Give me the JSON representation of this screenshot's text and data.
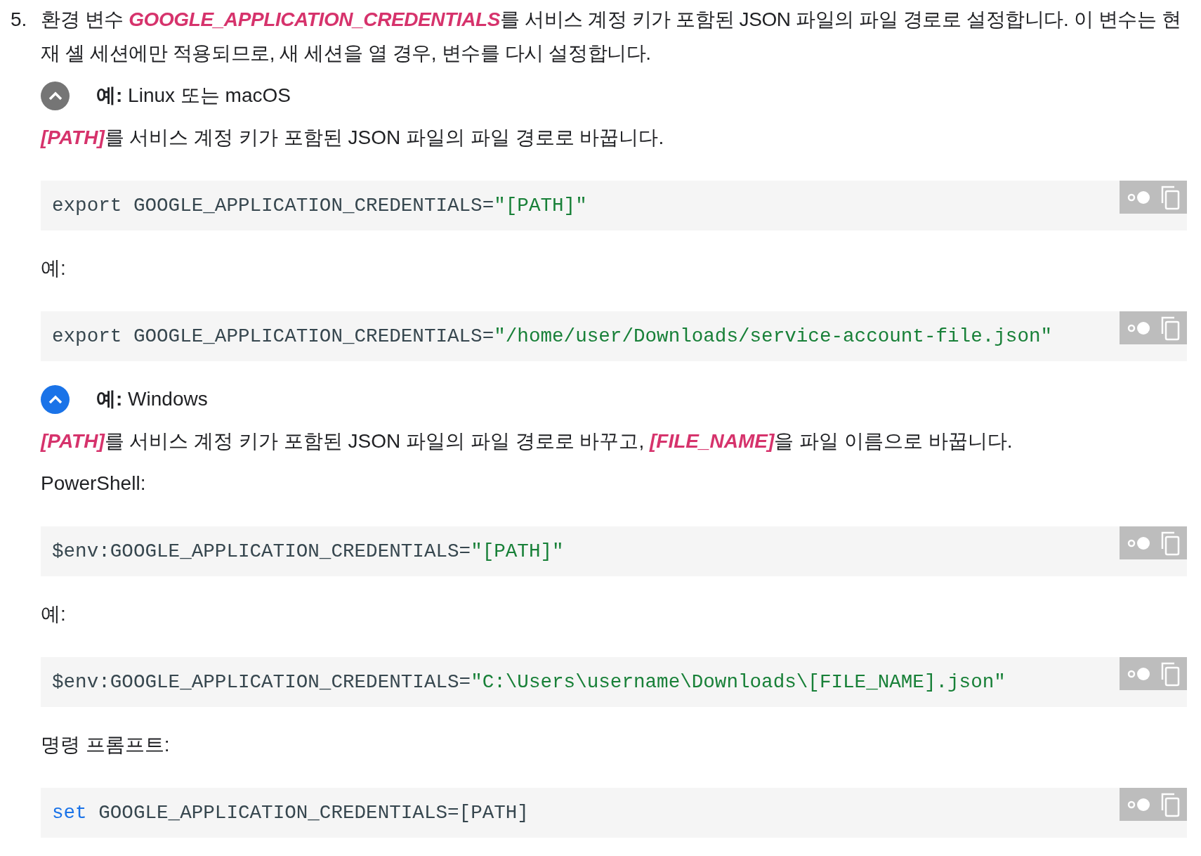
{
  "step": {
    "number": "5.",
    "parts": [
      {
        "kind": "plain",
        "text": "환경 변수 "
      },
      {
        "kind": "var",
        "text": "GOOGLE_APPLICATION_CREDENTIALS"
      },
      {
        "kind": "plain",
        "text": "를 서비스 계정 키가 포함된 JSON 파일의 파일 경로로 설정합니다. 이 변수는 현재 셸 세션에만 적용되므로, 새 세션을 열 경우, 변수를 다시 설정합니다."
      }
    ]
  },
  "sections": [
    {
      "label": "**예:** Linux 또는 macOS",
      "expanded": true,
      "focused": false,
      "blocks": [
        {
          "kind": "para",
          "parts": [
            {
              "kind": "var",
              "text": "[PATH]"
            },
            {
              "kind": "plain",
              "text": "를 서비스 계정 키가 포함된 JSON 파일의 파일 경로로 바꿉니다."
            }
          ]
        },
        {
          "kind": "code",
          "tokens": [
            {
              "kind": "plain",
              "text": "export GOOGLE_APPLICATION_CREDENTIALS="
            },
            {
              "kind": "string",
              "text": "\"[PATH]\""
            }
          ]
        },
        {
          "kind": "para",
          "parts": [
            {
              "kind": "plain",
              "text": "예:"
            }
          ]
        },
        {
          "kind": "code",
          "tokens": [
            {
              "kind": "plain",
              "text": "export GOOGLE_APPLICATION_CREDENTIALS="
            },
            {
              "kind": "string",
              "text": "\"/home/user/Downloads/service-account-file.json\""
            }
          ]
        }
      ]
    },
    {
      "label": "**예:** Windows",
      "expanded": true,
      "focused": true,
      "blocks": [
        {
          "kind": "para",
          "parts": [
            {
              "kind": "var",
              "text": "[PATH]"
            },
            {
              "kind": "plain",
              "text": "를 서비스 계정 키가 포함된 JSON 파일의 파일 경로로 바꾸고, "
            },
            {
              "kind": "var",
              "text": "[FILE_NAME]"
            },
            {
              "kind": "plain",
              "text": "을 파일 이름으로 바꿉니다."
            }
          ]
        },
        {
          "kind": "para",
          "parts": [
            {
              "kind": "plain",
              "text": "PowerShell:"
            }
          ]
        },
        {
          "kind": "code",
          "tokens": [
            {
              "kind": "plain",
              "text": "$env:GOOGLE_APPLICATION_CREDENTIALS="
            },
            {
              "kind": "string",
              "text": "\"[PATH]\""
            }
          ]
        },
        {
          "kind": "para",
          "parts": [
            {
              "kind": "plain",
              "text": "예:"
            }
          ]
        },
        {
          "kind": "code",
          "tokens": [
            {
              "kind": "plain",
              "text": "$env:GOOGLE_APPLICATION_CREDENTIALS="
            },
            {
              "kind": "string",
              "text": "\"C:\\Users\\username\\Downloads\\[FILE_NAME].json\""
            }
          ]
        },
        {
          "kind": "para",
          "parts": [
            {
              "kind": "plain",
              "text": "명령 프롬프트:"
            }
          ]
        },
        {
          "kind": "code",
          "tokens": [
            {
              "kind": "keyword",
              "text": "set"
            },
            {
              "kind": "plain",
              "text": " GOOGLE_APPLICATION_CREDENTIALS=[PATH]"
            }
          ]
        }
      ]
    }
  ]
}
